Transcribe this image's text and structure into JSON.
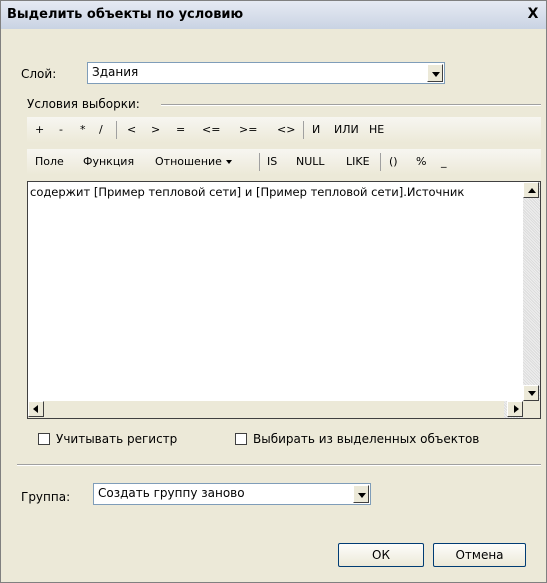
{
  "window": {
    "title": "Выделить объекты по условию",
    "close_glyph": "X"
  },
  "layer": {
    "label": "Слой:",
    "value": "Здания"
  },
  "conditions": {
    "label": "Условия выборки:"
  },
  "operators": [
    "+",
    "-",
    "*",
    "/",
    "<",
    ">",
    "=",
    "<=",
    ">=",
    "<>",
    "И",
    "ИЛИ",
    "НЕ"
  ],
  "functions_toolbar": {
    "field": "Поле",
    "function": "Функция",
    "relation": "Отношение",
    "is": "IS",
    "null": "NULL",
    "like": "LIKE",
    "parens": "()",
    "percent": "%",
    "underscore": "_"
  },
  "expression": "содержит [Пример тепловой сети] и [Пример тепловой сети].Источник",
  "options": {
    "case_sensitive": "Учитывать регистр",
    "from_selected": "Выбирать из выделенных объектов"
  },
  "group": {
    "label": "Группа:",
    "value": "Создать группу заново"
  },
  "buttons": {
    "ok": "ОК",
    "cancel": "Отмена"
  }
}
